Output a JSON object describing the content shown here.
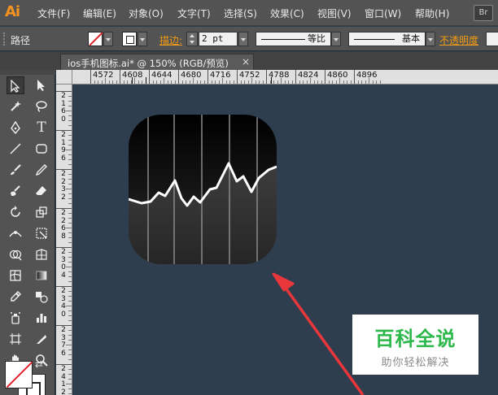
{
  "app": {
    "logo": "Ai",
    "bridge_badge": "Br"
  },
  "menu": [
    "文件(F)",
    "编辑(E)",
    "对象(O)",
    "文字(T)",
    "选择(S)",
    "效果(C)",
    "视图(V)",
    "窗口(W)",
    "帮助(H)"
  ],
  "control_bar": {
    "selection_label": "路径",
    "stroke_label": "描边:",
    "stroke_weight": "2 pt",
    "stroke_profile": "等比",
    "brush_definition": "基本",
    "opacity_label": "不透明度"
  },
  "document_tab": {
    "title": "ios手机图标.ai* @ 150% (RGB/预览)",
    "close": "×"
  },
  "ruler": {
    "horizontal_labels": [
      "4572",
      "4608",
      "4644",
      "4680",
      "4716",
      "4752",
      "4788",
      "4824",
      "4860",
      "4896"
    ],
    "vertical_labels": [
      "2160",
      "2196",
      "2232",
      "2268",
      "2304",
      "2340",
      "2376",
      "2412"
    ]
  },
  "canvas": {
    "background": "#2f3e4e",
    "icon_gradient_top": "#000000",
    "icon_gradient_bottom": "#3a3a3a",
    "chart_line_color": "#ffffff",
    "arrow_color": "#e8363b"
  },
  "watermark": {
    "title": "百科全说",
    "subtitle": "助你轻松解决",
    "title_color": "#2db84b"
  }
}
